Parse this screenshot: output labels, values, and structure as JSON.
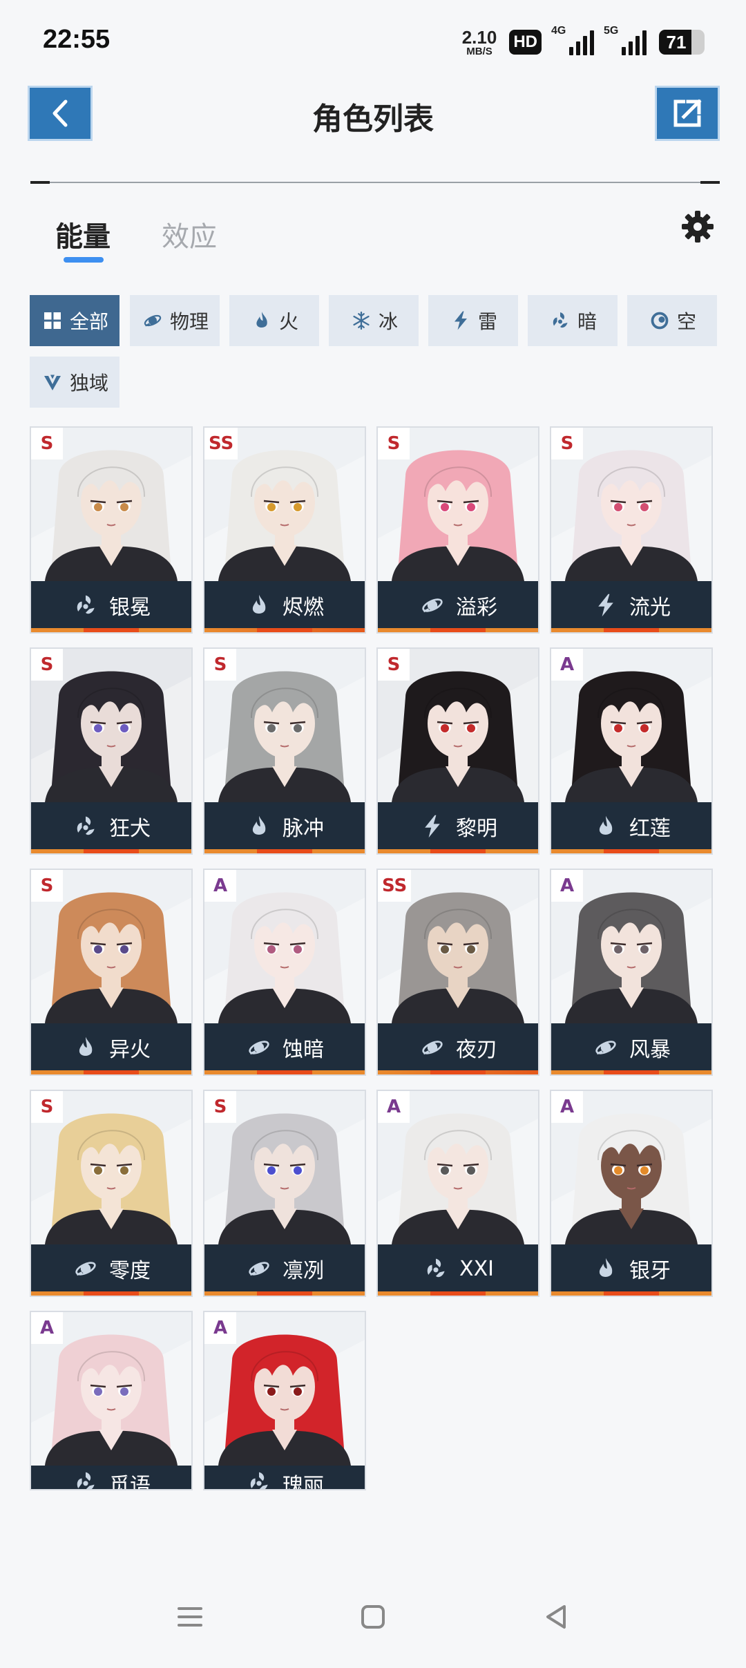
{
  "status": {
    "time": "22:55",
    "net_speed": "2.10",
    "net_unit": "MB/S",
    "hd": "HD",
    "sim1": "4G",
    "sim2": "5G",
    "battery": "71",
    "battery_level": 0.71
  },
  "header": {
    "title": "角色列表",
    "back_icon": "chevron-left-icon",
    "share_icon": "external-link-icon"
  },
  "tabs": [
    {
      "label": "能量",
      "active": true
    },
    {
      "label": "效应",
      "active": false
    }
  ],
  "settings_icon": "gear-icon",
  "filters": [
    {
      "label": "全部",
      "icon": "grid-icon",
      "active": true
    },
    {
      "label": "物理",
      "icon": "physical-icon"
    },
    {
      "label": "火",
      "icon": "fire-icon"
    },
    {
      "label": "冰",
      "icon": "ice-icon"
    },
    {
      "label": "雷",
      "icon": "thunder-icon"
    },
    {
      "label": "暗",
      "icon": "dark-icon"
    },
    {
      "label": "空",
      "icon": "void-icon"
    },
    {
      "label": "独域",
      "icon": "domain-icon"
    }
  ],
  "characters": [
    {
      "name": "银冕",
      "rank": "S",
      "element": "dark",
      "hair": "#e8e6e4",
      "skin": "#f3e4da",
      "eye": "#c98b4a",
      "bg": "#eef1f4"
    },
    {
      "name": "烬燃",
      "rank": "SS",
      "element": "fire",
      "hair": "#ecebe8",
      "skin": "#f3e4da",
      "eye": "#d69a2e",
      "bg": "#eef1f4"
    },
    {
      "name": "溢彩",
      "rank": "S",
      "element": "physical",
      "hair": "#f1a8b6",
      "skin": "#f7e2dc",
      "eye": "#d9497a",
      "bg": "#eef1f4"
    },
    {
      "name": "流光",
      "rank": "S",
      "element": "thunder",
      "hair": "#ece4e8",
      "skin": "#f7e6e2",
      "eye": "#d34f72",
      "bg": "#eef1f4"
    },
    {
      "name": "狂犬",
      "rank": "S",
      "element": "dark",
      "hair": "#2b2830",
      "skin": "#e9dcd8",
      "eye": "#6d5cc0",
      "bg": "#e6e8ec"
    },
    {
      "name": "脉冲",
      "rank": "S",
      "element": "fire",
      "hair": "#a4a6a6",
      "skin": "#f2e4dc",
      "eye": "#6b6b6b",
      "bg": "#eef1f4"
    },
    {
      "name": "黎明",
      "rank": "S",
      "element": "thunder",
      "hair": "#1e1a1c",
      "skin": "#f2e2dc",
      "eye": "#c42b2b",
      "bg": "#e9ebee"
    },
    {
      "name": "红莲",
      "rank": "A",
      "element": "fire",
      "hair": "#1f1a1c",
      "skin": "#f2e2dc",
      "eye": "#c42b2b",
      "bg": "#eef1f4"
    },
    {
      "name": "异火",
      "rank": "S",
      "element": "fire",
      "hair": "#cd8a5a",
      "skin": "#f1dccc",
      "eye": "#5a4a8a",
      "bg": "#eef1f4"
    },
    {
      "name": "蚀暗",
      "rank": "A",
      "element": "physical",
      "hair": "#ebe8ea",
      "skin": "#f6e8e4",
      "eye": "#b05b80",
      "bg": "#eef1f4"
    },
    {
      "name": "夜刃",
      "rank": "SS",
      "element": "physical",
      "hair": "#9a9694",
      "skin": "#e8d4c4",
      "eye": "#6a5a44",
      "bg": "#eef1f4"
    },
    {
      "name": "风暴",
      "rank": "A",
      "element": "physical",
      "hair": "#5d5b5d",
      "skin": "#f2e3dc",
      "eye": "#6e6268",
      "bg": "#eef1f4"
    },
    {
      "name": "零度",
      "rank": "S",
      "element": "physical",
      "hair": "#e8cf98",
      "skin": "#f4e4d6",
      "eye": "#8a6e3a",
      "bg": "#eef1f4"
    },
    {
      "name": "凛冽",
      "rank": "S",
      "element": "physical",
      "hair": "#c9c8cc",
      "skin": "#efe2dc",
      "eye": "#4c4fcf",
      "bg": "#eef1f4"
    },
    {
      "name": "XXI",
      "rank": "A",
      "element": "dark",
      "hair": "#ecebea",
      "skin": "#f4e6e0",
      "eye": "#5a5a5a",
      "bg": "#eef1f4"
    },
    {
      "name": "银牙",
      "rank": "A",
      "element": "fire",
      "hair": "#efefef",
      "skin": "#7a5648",
      "eye": "#e38a2a",
      "bg": "#eef1f4"
    },
    {
      "name": "觅语",
      "rank": "A",
      "element": "dark",
      "hair": "#efd0d4",
      "skin": "#f6e6e4",
      "eye": "#7a6cbc",
      "bg": "#eef1f4"
    },
    {
      "name": "瑰丽",
      "rank": "A",
      "element": "dark",
      "hair": "#d2242a",
      "skin": "#f2dcd6",
      "eye": "#8a1a1a",
      "bg": "#eef1f4"
    }
  ],
  "nav": {
    "menu_icon": "menu-icon",
    "home_icon": "home-icon",
    "back_icon": "back-triangle-icon"
  }
}
